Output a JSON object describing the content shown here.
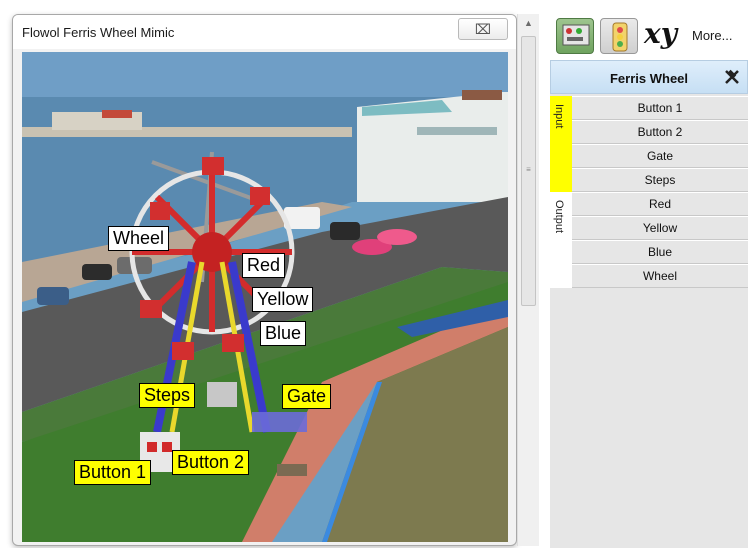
{
  "window": {
    "title": "Flowol Ferris Wheel Mimic",
    "close_glyph": "⌧"
  },
  "scene_labels": {
    "wheel": "Wheel",
    "red": "Red",
    "yellow": "Yellow",
    "blue": "Blue",
    "steps": "Steps",
    "gate": "Gate",
    "button1": "Button 1",
    "button2": "Button 2"
  },
  "toolbar": {
    "icons": [
      "circuit-board-icon",
      "traffic-light-icon",
      "xy-icon"
    ],
    "xy_label": "xy",
    "more_label": "More..."
  },
  "panel": {
    "title": "Ferris Wheel",
    "pin_icon": "pin-icon",
    "groups": [
      {
        "label": "Input",
        "color": "#ffff00",
        "items": [
          "Button 1",
          "Button 2",
          "Gate",
          "Steps"
        ]
      },
      {
        "label": "Output",
        "color": "#ffffff",
        "items": [
          "Red",
          "Yellow",
          "Blue",
          "Wheel"
        ]
      }
    ]
  },
  "colors": {
    "input_accent": "#ffff00",
    "label_yellow": "#ffff00",
    "panel_header": "#cfe4f7"
  }
}
